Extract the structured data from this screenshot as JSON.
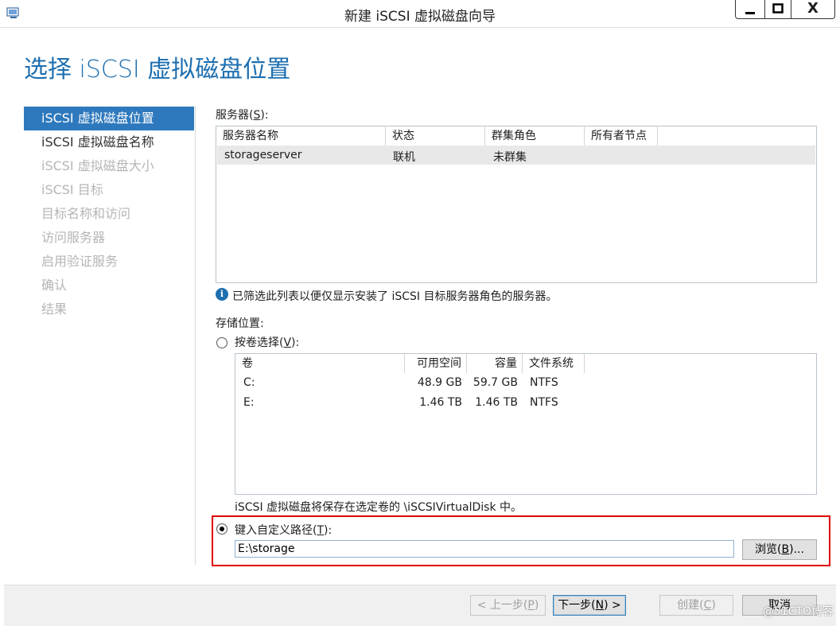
{
  "window": {
    "title": "新建 iSCSI 虚拟磁盘向导",
    "close_symbol": "X"
  },
  "page_title": "选择 iSCSI 虚拟磁盘位置",
  "nav": [
    {
      "label": "iSCSI 虚拟磁盘位置",
      "state": "selected"
    },
    {
      "label": "iSCSI 虚拟磁盘名称",
      "state": "normal"
    },
    {
      "label": "iSCSI 虚拟磁盘大小",
      "state": "disabled"
    },
    {
      "label": "iSCSI 目标",
      "state": "disabled"
    },
    {
      "label": "目标名称和访问",
      "state": "disabled"
    },
    {
      "label": "访问服务器",
      "state": "disabled"
    },
    {
      "label": "启用验证服务",
      "state": "disabled"
    },
    {
      "label": "确认",
      "state": "disabled"
    },
    {
      "label": "结果",
      "state": "disabled"
    }
  ],
  "server": {
    "label_pre": "服务器(",
    "label_key": "S",
    "label_post": "):",
    "columns": [
      "服务器名称",
      "状态",
      "群集角色",
      "所有者节点"
    ],
    "rows": [
      [
        "storageserver",
        "联机",
        "未群集",
        ""
      ]
    ]
  },
  "info_icon": "i",
  "info_text": "已筛选此列表以便仅显示安装了 iSCSI 目标服务器角色的服务器。",
  "storage": {
    "label": "存储位置:",
    "by_volume_pre": "按卷选择(",
    "by_volume_key": "V",
    "by_volume_post": "):",
    "columns": [
      "卷",
      "可用空间",
      "容量",
      "文件系统"
    ],
    "rows": [
      [
        "C:",
        "48.9 GB",
        "59.7 GB",
        "NTFS"
      ],
      [
        "E:",
        "1.46 TB",
        "1.46 TB",
        "NTFS"
      ]
    ],
    "note": "iSCSI 虚拟磁盘将保存在选定卷的 \\iSCSIVirtualDisk 中。",
    "custom_pre": "键入自定义路径(",
    "custom_key": "T",
    "custom_post": "):",
    "custom_value": "E:\\storage",
    "browse_pre": "浏览(",
    "browse_key": "B",
    "browse_post": ")..."
  },
  "footer": {
    "prev_pre": "< 上一步(",
    "prev_key": "P",
    "prev_post": ")",
    "next_pre": "下一步(",
    "next_key": "N",
    "next_post": ") >",
    "create_pre": "创建(",
    "create_key": "C",
    "create_post": ")",
    "cancel": "取消"
  },
  "watermark": "@51CTO博客"
}
